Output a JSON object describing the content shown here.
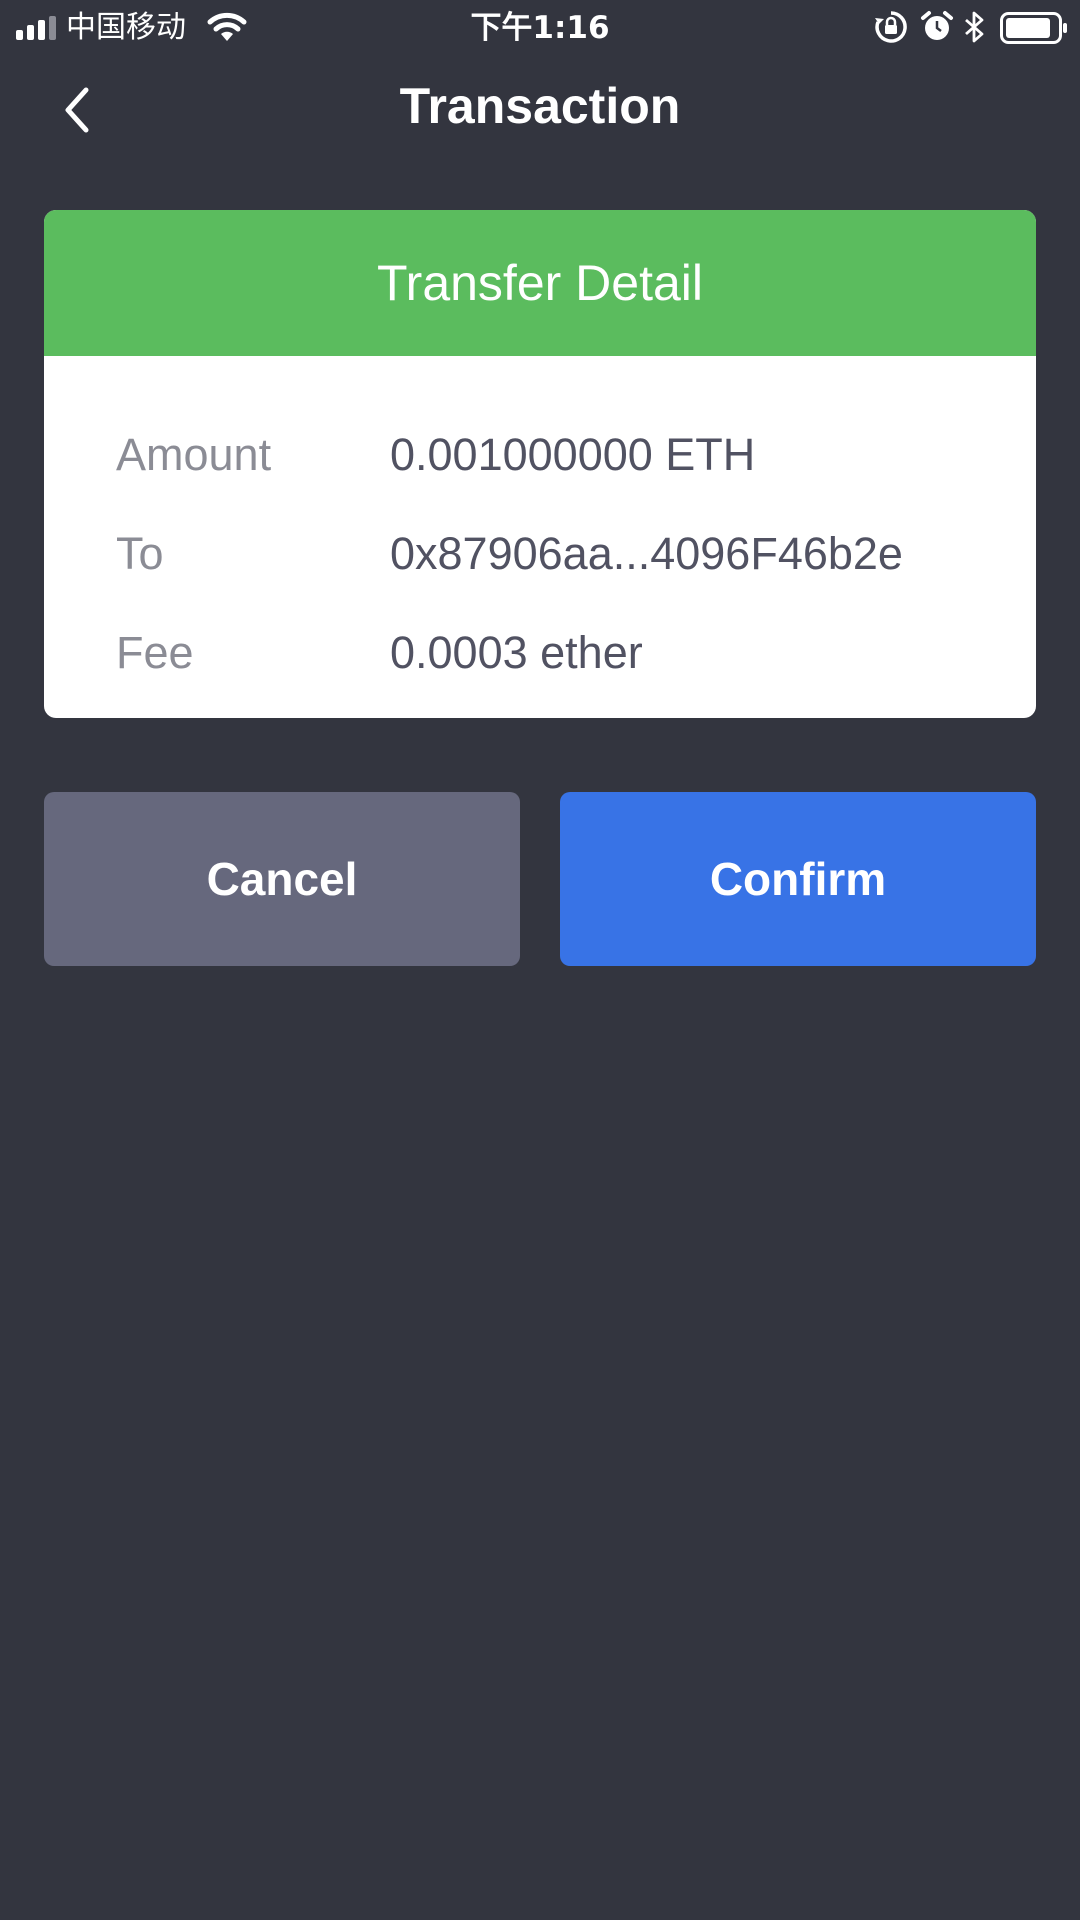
{
  "status_bar": {
    "carrier": "中国移动",
    "time": "下午1:16",
    "icons": [
      "signal-icon",
      "wifi-icon",
      "rotation-lock-icon",
      "alarm-icon",
      "bluetooth-icon",
      "battery-icon"
    ]
  },
  "nav": {
    "back_icon": "chevron-left-icon",
    "title": "Transaction"
  },
  "transfer_detail": {
    "header": "Transfer Detail",
    "rows": [
      {
        "label": "Amount",
        "value": "0.001000000 ETH"
      },
      {
        "label": "To",
        "value": "0x87906aa...4096F46b2e"
      },
      {
        "label": "Fee",
        "value": "0.0003 ether"
      }
    ]
  },
  "actions": {
    "cancel_label": "Cancel",
    "confirm_label": "Confirm"
  },
  "colors": {
    "background": "#33353f",
    "header_green": "#5bbc5e",
    "cancel_button": "#66687d",
    "confirm_button": "#3873e6",
    "label_text": "#8b8c95",
    "value_text": "#515262"
  }
}
